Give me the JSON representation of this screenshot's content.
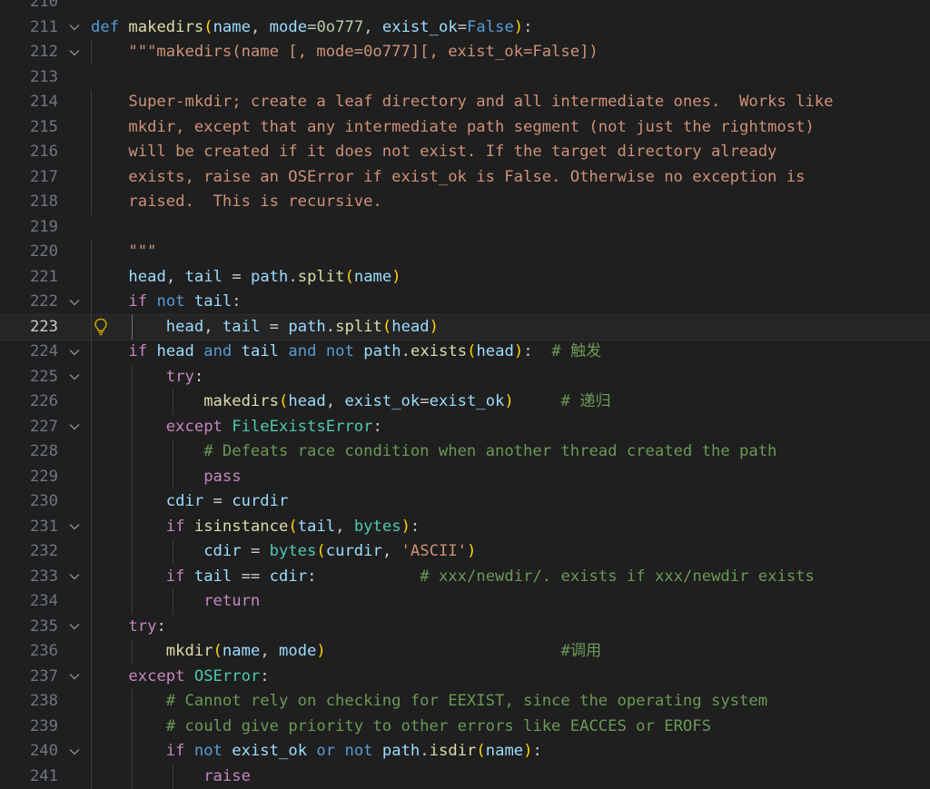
{
  "editor": {
    "theme": "dark",
    "colors": {
      "background": "#1f1f1f",
      "line_number": "#6e7681",
      "keyword": "#569cd6",
      "control": "#c586c0",
      "function": "#dcdcaa",
      "parameter": "#9cdcfe",
      "string": "#ce9178",
      "class": "#4ec9b0",
      "comment": "#6a9955"
    },
    "current_line": 223,
    "lines": [
      {
        "n": "210",
        "fold": false,
        "text": ""
      },
      {
        "n": "211",
        "fold": true,
        "text": "def makedirs(name, mode=0o777, exist_ok=False):"
      },
      {
        "n": "212",
        "fold": true,
        "text": "    \"\"\"makedirs(name [, mode=0o777][, exist_ok=False])"
      },
      {
        "n": "213",
        "fold": false,
        "text": ""
      },
      {
        "n": "214",
        "fold": false,
        "text": "    Super-mkdir; create a leaf directory and all intermediate ones.  Works like"
      },
      {
        "n": "215",
        "fold": false,
        "text": "    mkdir, except that any intermediate path segment (not just the rightmost)"
      },
      {
        "n": "216",
        "fold": false,
        "text": "    will be created if it does not exist. If the target directory already"
      },
      {
        "n": "217",
        "fold": false,
        "text": "    exists, raise an OSError if exist_ok is False. Otherwise no exception is"
      },
      {
        "n": "218",
        "fold": false,
        "text": "    raised.  This is recursive."
      },
      {
        "n": "219",
        "fold": false,
        "text": ""
      },
      {
        "n": "220",
        "fold": false,
        "text": "    \"\"\""
      },
      {
        "n": "221",
        "fold": false,
        "text": "    head, tail = path.split(name)"
      },
      {
        "n": "222",
        "fold": true,
        "text": "    if not tail:"
      },
      {
        "n": "223",
        "fold": false,
        "text": "        head, tail = path.split(head)"
      },
      {
        "n": "224",
        "fold": true,
        "text": "    if head and tail and not path.exists(head):  # 触发"
      },
      {
        "n": "225",
        "fold": true,
        "text": "        try:"
      },
      {
        "n": "226",
        "fold": false,
        "text": "            makedirs(head, exist_ok=exist_ok)     # 递归"
      },
      {
        "n": "227",
        "fold": true,
        "text": "        except FileExistsError:"
      },
      {
        "n": "228",
        "fold": false,
        "text": "            # Defeats race condition when another thread created the path"
      },
      {
        "n": "229",
        "fold": false,
        "text": "            pass"
      },
      {
        "n": "230",
        "fold": false,
        "text": "        cdir = curdir"
      },
      {
        "n": "231",
        "fold": true,
        "text": "        if isinstance(tail, bytes):"
      },
      {
        "n": "232",
        "fold": false,
        "text": "            cdir = bytes(curdir, 'ASCII')"
      },
      {
        "n": "233",
        "fold": true,
        "text": "        if tail == cdir:           # xxx/newdir/. exists if xxx/newdir exists"
      },
      {
        "n": "234",
        "fold": false,
        "text": "            return"
      },
      {
        "n": "235",
        "fold": true,
        "text": "    try:"
      },
      {
        "n": "236",
        "fold": false,
        "text": "        mkdir(name, mode)                         #调用"
      },
      {
        "n": "237",
        "fold": true,
        "text": "    except OSError:"
      },
      {
        "n": "238",
        "fold": false,
        "text": "        # Cannot rely on checking for EEXIST, since the operating system"
      },
      {
        "n": "239",
        "fold": false,
        "text": "        # could give priority to other errors like EACCES or EROFS"
      },
      {
        "n": "240",
        "fold": true,
        "text": "        if not exist_ok or not path.isdir(name):"
      },
      {
        "n": "241",
        "fold": false,
        "text": "            raise"
      }
    ]
  },
  "icons": {
    "fold": "chevron-down-icon",
    "bulb": "lightbulb-icon",
    "breakpoint": "breakpoint-icon"
  }
}
